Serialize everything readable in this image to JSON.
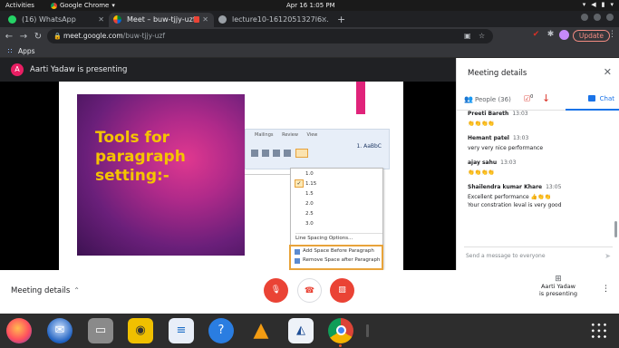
{
  "os_topbar": {
    "activities": "Activities",
    "app_name": "Google Chrome",
    "clock": "Apr 16  1:05 PM"
  },
  "browser": {
    "tabs": [
      {
        "title": "(16) WhatsApp",
        "active": false
      },
      {
        "title": "Meet – buw-tjjy-uzf",
        "active": true
      },
      {
        "title": "lecture10-1612051327l6...",
        "active": false
      }
    ],
    "url_host": "meet.google.com",
    "url_path": "/buw-tjjy-uzf",
    "update_label": "Update",
    "bookmarks_apps": "Apps"
  },
  "meet": {
    "presenter_initial": "A",
    "presenter_banner": "Aarti Yadaw is presenting",
    "slide": {
      "title_lines": [
        "Tools for",
        "paragraph",
        "setting:-"
      ],
      "ribbon_menu": "Mailings   Review   View",
      "ribbon_style": "1. AaBbC",
      "line_spacing_options": [
        "1.0",
        "1.15",
        "1.5",
        "2.0",
        "2.5",
        "3.0"
      ],
      "menu_options": [
        "Line Spacing Options...",
        "Add Space Before Paragraph",
        "Remove Space after Paragraph"
      ]
    },
    "panel": {
      "title": "Meeting details",
      "people_tab": "People (36)",
      "extra_badge": "0",
      "chat_tab": "Chat",
      "messages": [
        {
          "sender": "Preeti Bareth",
          "time": "13:03",
          "text": "👏👏👏👏"
        },
        {
          "sender": "Hemant patel",
          "time": "13:03",
          "text": "very very nice performance"
        },
        {
          "sender": "ajay sahu",
          "time": "13:03",
          "text": "👏👏👏👏"
        },
        {
          "sender": "Shailendra kumar Khare",
          "time": "13:05",
          "text": "Excellent performance 👍👏👏",
          "text2": "Your constration leval is very good"
        }
      ],
      "compose_placeholder": "Send a message to everyone"
    },
    "callbar": {
      "meeting_details": "Meeting details",
      "presenting_line1": "Aarti Yadaw",
      "presenting_line2": "is presenting"
    }
  },
  "dock": {
    "apps": [
      "firefox",
      "thunderbird",
      "files",
      "rhythmbox",
      "libreoffice-writer",
      "help",
      "vlc",
      "inkscape",
      "chrome"
    ]
  },
  "colors": {
    "meet_red": "#ea4335",
    "chat_blue": "#1a73e8",
    "slide_yellow": "#f5c400"
  }
}
